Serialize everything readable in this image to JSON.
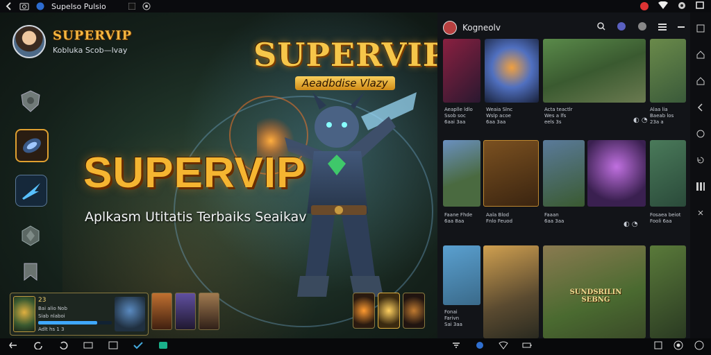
{
  "statusbar": {
    "app_title": "Supelso Pulsio",
    "icons": [
      "back-icon",
      "screenshot-icon",
      "app-badge-icon",
      "stop-icon",
      "record-icon",
      "notification-icon",
      "wifi-icon",
      "settings-icon",
      "window-icon"
    ]
  },
  "profile": {
    "title": "SUPERVIP",
    "subtitle": "Kobluka Scob—lvay"
  },
  "banner": {
    "logo_title": "SUPERVIP",
    "logo_subtitle": "Aeadbdise Vlazy",
    "main_title": "SUPERVIP",
    "tagline": "Aplkasm Utitatis Terbaiks Seaikav"
  },
  "hud": {
    "level": "23",
    "stat_lines": [
      "Bai alio Nob",
      "Siab nlaboi",
      "Adlt hs 1 3"
    ],
    "bar_fill": 0.8
  },
  "panel": {
    "title": "Kogneolv",
    "captions": [
      [
        "Aeaplle ldlo",
        "Ssob soc",
        "6aai 3aa"
      ],
      [
        "Weaia Slnc",
        "Wslp acoe",
        "6aa 3aa"
      ],
      [
        "Acta teactlr",
        "Wes a lfs",
        "eels 3s"
      ],
      [
        "Alaa lia",
        "Baeab los",
        "23a a"
      ],
      [
        "Faane Fhde",
        "6aa 8aa"
      ],
      [
        "Aala Blod",
        "Fnlo Feuod"
      ],
      [
        "Faaan",
        "6aa 3aa"
      ],
      [
        "Fosaea beiot",
        "Fooli 6aa"
      ],
      [
        "Fonai",
        "Farivn",
        "Sai 3aa"
      ]
    ],
    "tile_label": "SUNDSRILIN SEBNG"
  },
  "colors": {
    "gold": "#f5b531",
    "panel_bg": "#121418",
    "accent_blue": "#3fa8ff"
  }
}
